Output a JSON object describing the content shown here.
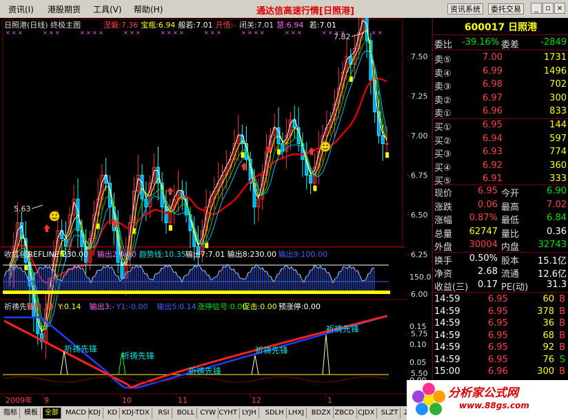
{
  "menu": {
    "items": [
      "资讯(I)",
      "港股期货",
      "工具(V)",
      "帮助(H)"
    ],
    "title": "通达信高速行情[日照港]",
    "btn_info": "资讯系统",
    "btn_trade": "委托交易"
  },
  "main_chart": {
    "title": "日照港(日线) 终极主图",
    "legend": [
      {
        "text": "涅磐:7.36",
        "color": "#ff4040"
      },
      {
        "text": "宝瓶:6.94",
        "color": "#ffff00"
      },
      {
        "text": "般若:7.01",
        "color": "#ffffff"
      },
      {
        "text": "开悟:-",
        "color": "#ff4040"
      },
      {
        "text": "闭关:7.01",
        "color": "#dddddd"
      },
      {
        "text": "慧:6.94",
        "color": "#ff60ff"
      },
      {
        "text": "若:7.01",
        "color": "#ffffff"
      }
    ],
    "high_label": "7.82",
    "low_label": "5.63",
    "y_ticks": [
      "7.50",
      "7.25",
      "7.00",
      "6.75",
      "6.50",
      "6.25",
      "6.00",
      "5.75",
      "5.50"
    ]
  },
  "ind1": {
    "legend": [
      {
        "text": "收红包1",
        "color": "#dddddd"
      },
      {
        "text": "REFLINE:230.00",
        "color": "#ffffff"
      },
      {
        "text": "输出2:0.00",
        "color": "#ff60ff"
      },
      {
        "text": "趋势线:10.35",
        "color": "#00e0e0"
      },
      {
        "text": "输出7:7.01",
        "color": "#ffffff"
      },
      {
        "text": "输出8:230.00",
        "color": "#ffffff"
      },
      {
        "text": "输出9:100.00",
        "color": "#4060ff"
      }
    ],
    "y_tick": "150.0"
  },
  "ind2": {
    "legend": [
      {
        "text": "祈祷先锋",
        "color": "#dddddd"
      },
      {
        "text": "警:0.14",
        "color": "#ff4040"
      },
      {
        "text": "Y:0.14",
        "color": "#ffff00"
      },
      {
        "text": "输出3:-",
        "color": "#ff60ff"
      },
      {
        "text": "Y1:-0.00",
        "color": "#4060ff"
      },
      {
        "text": "输出5:0.14",
        "color": "#4060ff"
      },
      {
        "text": "涨停信号:0.00",
        "color": "#00e000"
      },
      {
        "text": "促击:0.00",
        "color": "#ffff00"
      },
      {
        "text": "预涨停:0.00",
        "color": "#ffffff"
      }
    ],
    "annotations": [
      "祈祷先锋",
      "祈祷先锋",
      "祈祷先锋",
      "祈祷先锋",
      "祈祷先锋"
    ],
    "y_ticks": [
      "0.15",
      "0.10",
      "0.05",
      "0.00"
    ]
  },
  "time_axis": {
    "labels": [
      "2009年",
      "9",
      "10",
      "11",
      "12",
      "1"
    ],
    "period": "日线"
  },
  "quote": {
    "code_name": "600017 日照港",
    "weibi": {
      "label": "委比",
      "value": "-39.16%",
      "label2": "委差",
      "value2": "-2849"
    },
    "asks": [
      {
        "label": "卖⑤",
        "price": "7.00",
        "vol": "1731"
      },
      {
        "label": "卖④",
        "price": "6.99",
        "vol": "1496"
      },
      {
        "label": "卖③",
        "price": "6.98",
        "vol": "702"
      },
      {
        "label": "卖②",
        "price": "6.97",
        "vol": "300"
      },
      {
        "label": "卖①",
        "price": "6.96",
        "vol": "833"
      }
    ],
    "bids": [
      {
        "label": "买①",
        "price": "6.95",
        "vol": "144"
      },
      {
        "label": "买②",
        "price": "6.94",
        "vol": "597"
      },
      {
        "label": "买③",
        "price": "6.93",
        "vol": "774"
      },
      {
        "label": "买④",
        "price": "6.92",
        "vol": "360"
      },
      {
        "label": "买⑤",
        "price": "6.91",
        "vol": "333"
      }
    ],
    "stats": [
      {
        "l1": "现价",
        "v1": "6.95",
        "c1": "red",
        "l2": "今开",
        "v2": "6.90",
        "c2": "grn"
      },
      {
        "l1": "涨跌",
        "v1": "0.06",
        "c1": "red",
        "l2": "最高",
        "v2": "7.02",
        "c2": "red"
      },
      {
        "l1": "涨幅",
        "v1": "0.87%",
        "c1": "red",
        "l2": "最低",
        "v2": "6.84",
        "c2": "grn"
      },
      {
        "l1": "总量",
        "v1": "62747",
        "c1": "yel",
        "l2": "量比",
        "v2": "0.36",
        "c2": "wht"
      },
      {
        "l1": "外盘",
        "v1": "30004",
        "c1": "red",
        "l2": "内盘",
        "v2": "32743",
        "c2": "grn"
      }
    ],
    "fin": [
      {
        "l1": "换手",
        "v1": "0.50%",
        "l2": "股本",
        "v2": "15.1亿"
      },
      {
        "l1": "净资",
        "v1": "2.68",
        "l2": "流通",
        "v2": "12.6亿"
      },
      {
        "l1": "收益(三)",
        "v1": "0.17",
        "l2": "PE(动)",
        "v2": "31.3"
      }
    ],
    "ticks": [
      {
        "time": "14:59",
        "price": "6.95",
        "vol": "60",
        "side": "B"
      },
      {
        "time": "14:59",
        "price": "6.95",
        "vol": "378",
        "side": "B"
      },
      {
        "time": "14:59",
        "price": "6.95",
        "vol": "36",
        "side": "B"
      },
      {
        "time": "14:59",
        "price": "6.95",
        "vol": "68",
        "side": "B"
      },
      {
        "time": "14:59",
        "price": "6.95",
        "vol": "92",
        "side": "B"
      },
      {
        "time": "14:59",
        "price": "6.95",
        "vol": "76",
        "side": "S"
      },
      {
        "time": "15:00",
        "price": "6.96",
        "vol": "300",
        "side": "B"
      }
    ]
  },
  "tabs": [
    "指标",
    "模板",
    "全部",
    "MACD",
    "KDJ",
    "KD",
    "KDJ-TDX",
    "RSI",
    "BOLL",
    "CYW",
    "CYHT",
    "LYJH",
    "SDLH",
    "LHXJ",
    "BDZX",
    "ZBCD",
    "CJDX",
    "SLZT",
    "ZLMM"
  ],
  "watermark": {
    "text": "分析家公式网",
    "url": "www.88gs.com"
  }
}
